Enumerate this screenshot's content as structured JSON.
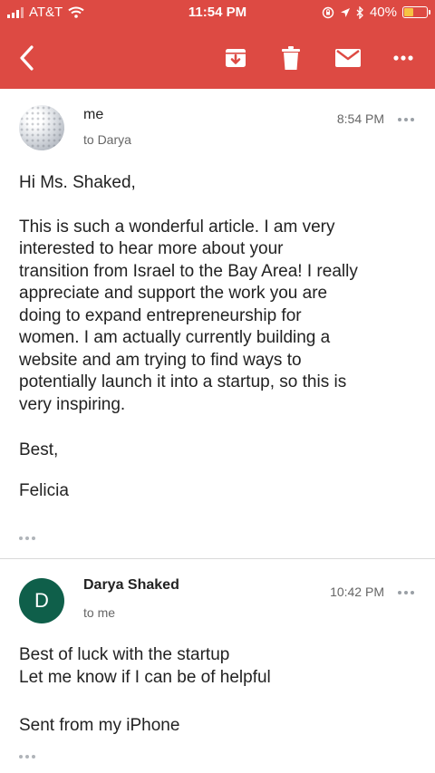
{
  "status_bar": {
    "carrier": "AT&T",
    "time": "11:54 PM",
    "battery_percent": "40%",
    "battery_level": 0.4,
    "battery_color": "#f6c343"
  },
  "toolbar": {
    "background": "#dd4a43",
    "icons": [
      "back-chevron-icon",
      "archive-icon",
      "trash-icon",
      "mail-icon",
      "more-icon"
    ]
  },
  "messages": [
    {
      "sender": "me",
      "recipient": "to Darya",
      "time": "8:54 PM",
      "greeting": "Hi Ms. Shaked,",
      "paragraph": "This is such a wonderful article. I am very\ninterested to hear more about your\ntransition from Israel to the Bay Area! I really\nappreciate and support the work you are\ndoing to expand entrepreneurship for\nwomen. I am actually currently building a\nwebsite and am trying to find ways to\npotentially launch it into a startup, so this is\nvery inspiring.",
      "closing": "Best,",
      "signature": "Felicia"
    },
    {
      "avatar_initial": "D",
      "avatar_color": "#0f5f4a",
      "sender": "Darya Shaked",
      "recipient": "to me",
      "time": "10:42 PM",
      "line1": "Best of luck with the startup",
      "line2": "Let me know if I can be of helpful",
      "footer": "Sent from my iPhone"
    }
  ]
}
